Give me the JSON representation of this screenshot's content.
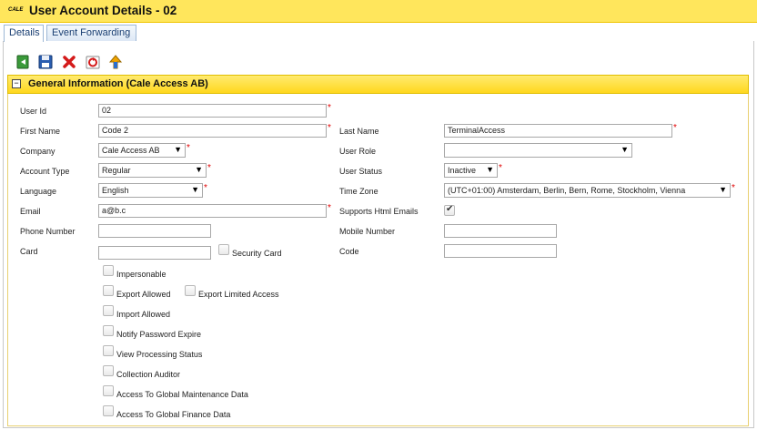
{
  "header": {
    "logo_text": "CALE",
    "title": "User Account Details - 02"
  },
  "tabs": [
    {
      "label": "Details",
      "active": true
    },
    {
      "label": "Event Forwarding",
      "active": false
    }
  ],
  "toolbar": {
    "buttons": [
      "back-icon",
      "save-icon",
      "delete-icon",
      "refresh-icon",
      "upload-icon"
    ]
  },
  "section": {
    "collapse_symbol": "−",
    "title": "General Information (Cale Access AB)"
  },
  "form": {
    "user_id": {
      "label": "User Id",
      "value": "02"
    },
    "first_name": {
      "label": "First Name",
      "value": "Code 2"
    },
    "last_name": {
      "label": "Last Name",
      "value": "TerminalAccess"
    },
    "company": {
      "label": "Company",
      "value": "Cale Access AB"
    },
    "user_role": {
      "label": "User Role",
      "value": ""
    },
    "account_type": {
      "label": "Account Type",
      "value": "Regular"
    },
    "user_status": {
      "label": "User Status",
      "value": "Inactive"
    },
    "language": {
      "label": "Language",
      "value": "English"
    },
    "time_zone": {
      "label": "Time Zone",
      "value": "(UTC+01:00) Amsterdam, Berlin, Bern, Rome, Stockholm, Vienna"
    },
    "email": {
      "label": "Email",
      "value": "a@b.c"
    },
    "supports_html_emails": {
      "label": "Supports Html Emails",
      "checked": true
    },
    "phone_number": {
      "label": "Phone Number",
      "value": ""
    },
    "mobile_number": {
      "label": "Mobile Number",
      "value": ""
    },
    "card": {
      "label": "Card",
      "value": ""
    },
    "security_card": {
      "label": "Security Card",
      "checked": false
    },
    "code": {
      "label": "Code",
      "value": ""
    },
    "impersonable": {
      "label": "Impersonable",
      "checked": false
    },
    "export_allowed": {
      "label": "Export Allowed",
      "checked": false
    },
    "export_limited_access": {
      "label": "Export Limited Access",
      "checked": false
    },
    "import_allowed": {
      "label": "Import Allowed",
      "checked": false
    },
    "notify_password_expire": {
      "label": "Notify Password Expire",
      "checked": false
    },
    "view_processing_status": {
      "label": "View Processing Status",
      "checked": false
    },
    "collection_auditor": {
      "label": "Collection Auditor",
      "checked": false
    },
    "access_global_maintenance": {
      "label": "Access To Global Maintenance Data",
      "checked": false
    },
    "access_global_finance": {
      "label": "Access To Global Finance Data",
      "checked": false
    }
  },
  "required_marker": "*",
  "dropdown_arrow": "▼"
}
